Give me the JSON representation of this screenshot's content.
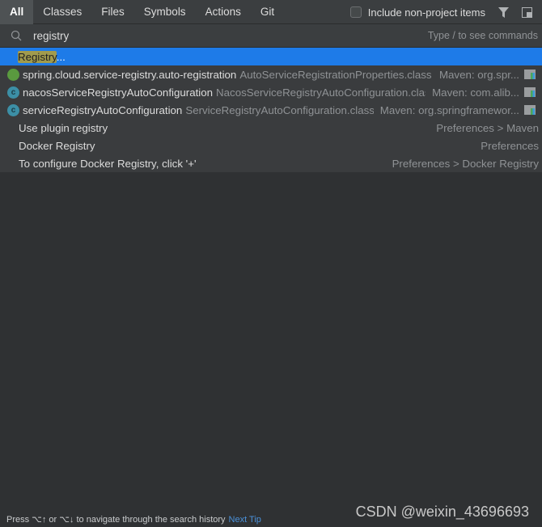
{
  "tabs": [
    "All",
    "Classes",
    "Files",
    "Symbols",
    "Actions",
    "Git"
  ],
  "include_label": "Include non-project items",
  "search": {
    "query": "registry",
    "hint": "Type / to see commands"
  },
  "selected": {
    "match": "Registry",
    "rest": "..."
  },
  "results": [
    {
      "icon": "spring-icon",
      "name": "spring.cloud.service-registry.auto-registration",
      "file": "AutoServiceRegistrationProperties.class",
      "location": "Maven: org.spr..."
    },
    {
      "icon": "class-icon",
      "name": "nacosServiceRegistryAutoConfiguration",
      "file": "NacosServiceRegistryAutoConfiguration.class",
      "location": "Maven: com.alib..."
    },
    {
      "icon": "class-icon",
      "name": "serviceRegistryAutoConfiguration",
      "file": "ServiceRegistryAutoConfiguration.class",
      "location": "Maven: org.springframewor..."
    }
  ],
  "actions": [
    {
      "name": "Use plugin registry",
      "location": "Preferences > Maven"
    },
    {
      "name": "Docker Registry",
      "location": "Preferences"
    },
    {
      "name": "To configure Docker Registry, click '+'",
      "location": "Preferences > Docker Registry"
    }
  ],
  "footer": {
    "tip": "Press ⌥↑ or ⌥↓ to navigate through the search history",
    "next": "Next Tip"
  },
  "watermark": "CSDN @weixin_43696693"
}
